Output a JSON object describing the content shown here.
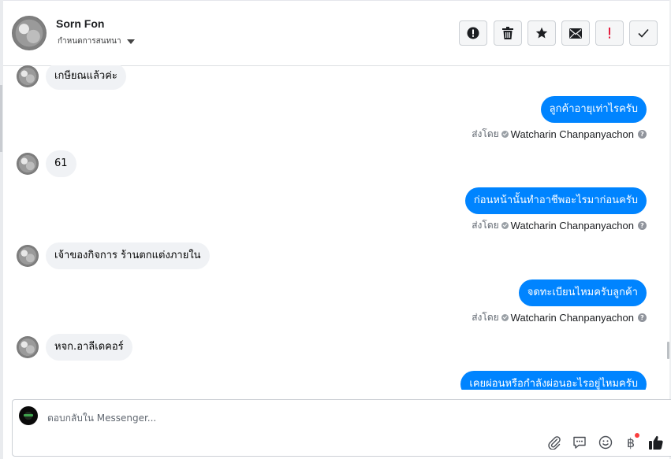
{
  "header": {
    "name": "Sorn Fon",
    "subtitle": "กำหนดการสนทนา",
    "actions": [
      {
        "name": "report-spam-button",
        "icon": "alert-circle-icon"
      },
      {
        "name": "delete-button",
        "icon": "trash-icon"
      },
      {
        "name": "star-button",
        "icon": "star-icon"
      },
      {
        "name": "mark-unread-button",
        "icon": "envelope-icon"
      },
      {
        "name": "flag-important-button",
        "icon": "exclamation-icon",
        "color": "#e41e3f"
      },
      {
        "name": "mark-done-button",
        "icon": "checkmark-icon"
      }
    ]
  },
  "messages": [
    {
      "dir": "in",
      "text": "เกษียณแล้วค่ะ"
    },
    {
      "dir": "out",
      "text": "ลูกค้าอายุเท่าไรครับ"
    },
    {
      "dir": "in",
      "text": "61"
    },
    {
      "dir": "out",
      "text": "ก่อนหน้านั้นทำอาชีพอะไรมาก่อนครับ"
    },
    {
      "dir": "in",
      "text": "เจ้าของกิจการ ร้านตกแต่งภายใน"
    },
    {
      "dir": "out",
      "text": "จดทะเบียนไหมครับลูกค้า"
    },
    {
      "dir": "in",
      "text": "หจก.อาลีเดคอร์"
    },
    {
      "dir": "out",
      "text": "เคยผ่อนหรือกำลังผ่อนอะไรอยู่ไหมครับ"
    }
  ],
  "sent_by": {
    "prefix": "ส่งโดย",
    "agent": "Watcharin Chanpanyachon",
    "help": "?"
  },
  "composer": {
    "placeholder": "ตอบกลับใน Messenger...",
    "icons": [
      "paperclip-icon",
      "saved-replies-icon",
      "emoji-icon",
      "baht-payment-icon",
      "thumbs-up-icon"
    ],
    "baht_symbol": "฿",
    "accent": "#1877f2"
  }
}
